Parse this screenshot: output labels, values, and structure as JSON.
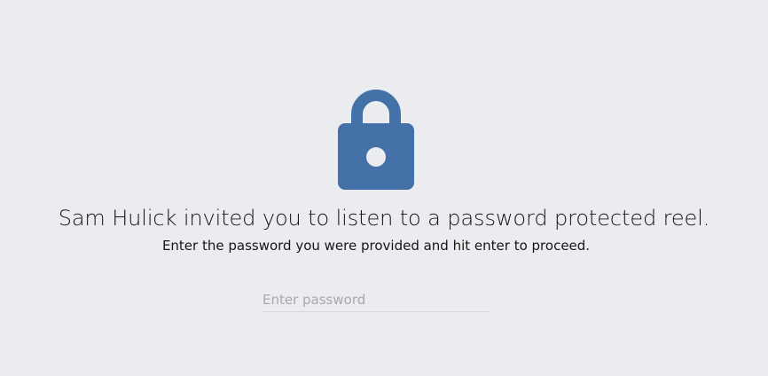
{
  "lock": {
    "icon": "lock-icon",
    "color": "#4471a8"
  },
  "heading": "Sam Hulick invited you to listen to a password protected reel.",
  "instructions": "Enter the password you were provided and hit enter to proceed.",
  "password": {
    "placeholder": "Enter password",
    "value": ""
  }
}
